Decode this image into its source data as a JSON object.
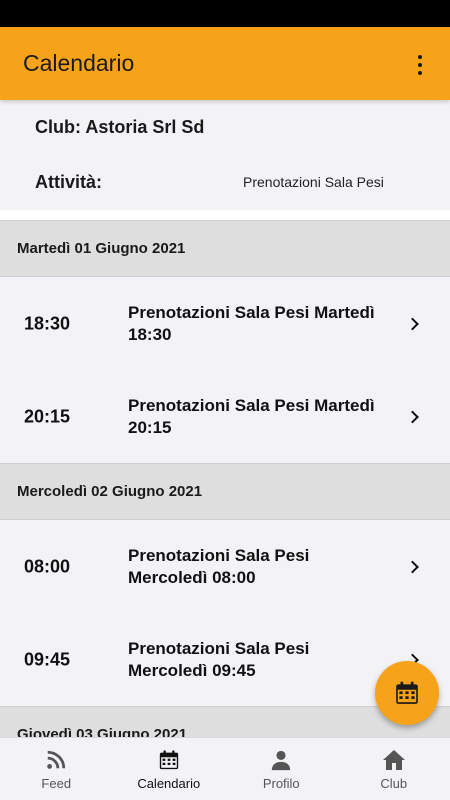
{
  "app_bar": {
    "title": "Calendario",
    "menu_icon": "more-vert-icon"
  },
  "club_info": {
    "club_label": "Club: Astoria Srl Sd",
    "activity_label": "Attività:",
    "activity_value": "Prenotazioni Sala Pesi"
  },
  "days": [
    {
      "date": "Martedì 01 Giugno 2021",
      "events": [
        {
          "time": "18:30",
          "title": "Prenotazioni Sala Pesi Martedì 18:30"
        },
        {
          "time": "20:15",
          "title": "Prenotazioni Sala Pesi Martedì 20:15"
        }
      ]
    },
    {
      "date": "Mercoledì 02 Giugno 2021",
      "events": [
        {
          "time": "08:00",
          "title": "Prenotazioni Sala Pesi Mercoledì 08:00"
        },
        {
          "time": "09:45",
          "title": "Prenotazioni Sala Pesi Mercoledì 09:45"
        }
      ]
    },
    {
      "date": "Giovedì 03 Giugno 2021",
      "events": []
    }
  ],
  "fab": {
    "icon": "calendar-icon"
  },
  "bottom_nav": [
    {
      "label": "Feed",
      "icon": "rss-icon",
      "active": false
    },
    {
      "label": "Calendario",
      "icon": "calendar-icon",
      "active": true
    },
    {
      "label": "Profilo",
      "icon": "person-icon",
      "active": false
    },
    {
      "label": "Club",
      "icon": "home-icon",
      "active": false
    }
  ],
  "colors": {
    "accent": "#f6a31a",
    "background": "#f3f3f7",
    "header": "#dedede",
    "status_bar": "#000000"
  }
}
